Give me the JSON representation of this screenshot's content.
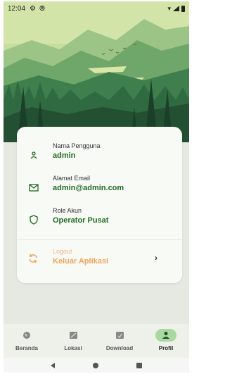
{
  "status_bar": {
    "time": "12:04",
    "icons": [
      "gear-icon",
      "location-icon",
      "wifi-icon",
      "signal-icon",
      "battery-icon"
    ]
  },
  "profile": {
    "username_label": "Nama Pengguna",
    "username_value": "admin",
    "email_label": "Alamat Email",
    "email_value": "admin@admin.com",
    "role_label": "Role Akun",
    "role_value": "Operator Pusat",
    "logout_label": "Logout",
    "logout_value": "Keluar Aplikasi"
  },
  "bottom_nav": {
    "items": [
      {
        "label": "Beranda",
        "icon": "globe-icon"
      },
      {
        "label": "Lokasi",
        "icon": "map-icon"
      },
      {
        "label": "Download",
        "icon": "download-icon"
      },
      {
        "label": "Profil",
        "icon": "person-icon",
        "active": true
      }
    ]
  },
  "colors": {
    "primary_green": "#1f6b21",
    "accent_orange": "#f0a45c",
    "active_pill": "#a9d9a1",
    "hero_sky": "#c9de9f"
  }
}
